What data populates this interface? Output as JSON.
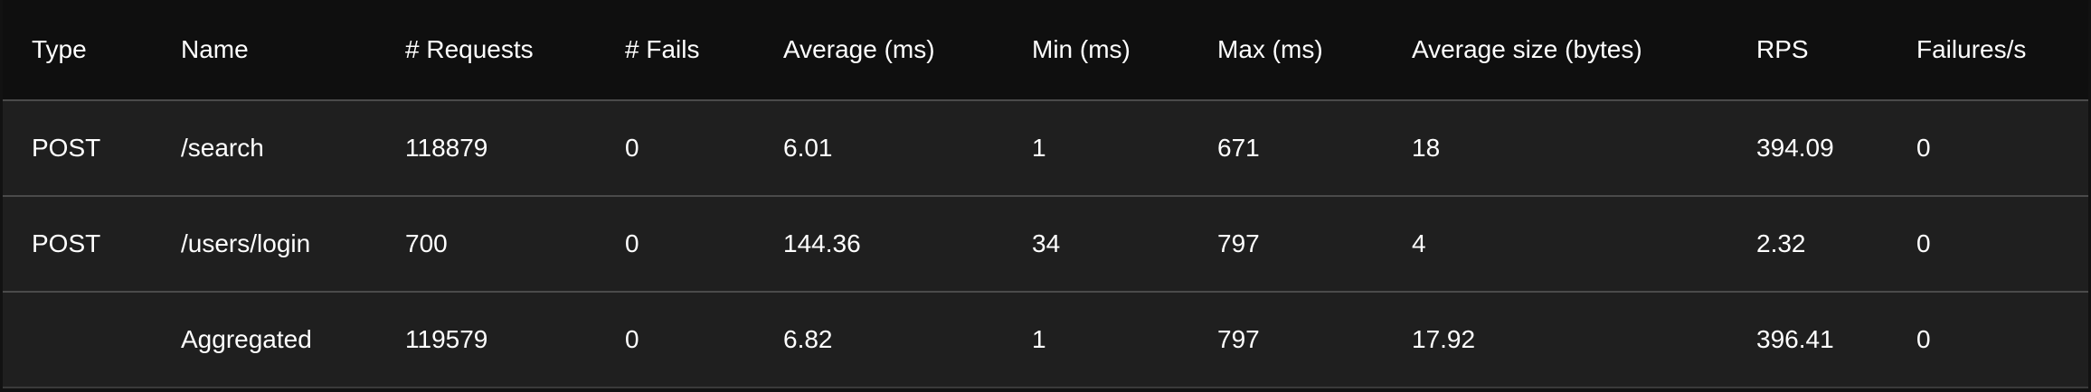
{
  "table": {
    "headers": [
      "Type",
      "Name",
      "# Requests",
      "# Fails",
      "Average (ms)",
      "Min (ms)",
      "Max (ms)",
      "Average size (bytes)",
      "RPS",
      "Failures/s"
    ],
    "rows": [
      {
        "type": "POST",
        "name": "/search",
        "requests": "118879",
        "fails": "0",
        "average_ms": "6.01",
        "min_ms": "1",
        "max_ms": "671",
        "average_size": "18",
        "rps": "394.09",
        "failures_per_s": "0"
      },
      {
        "type": "POST",
        "name": "/users/login",
        "requests": "700",
        "fails": "0",
        "average_ms": "144.36",
        "min_ms": "34",
        "max_ms": "797",
        "average_size": "4",
        "rps": "2.32",
        "failures_per_s": "0"
      },
      {
        "type": "",
        "name": "Aggregated",
        "requests": "119579",
        "fails": "0",
        "average_ms": "6.82",
        "min_ms": "1",
        "max_ms": "797",
        "average_size": "17.92",
        "rps": "396.41",
        "failures_per_s": "0"
      }
    ]
  }
}
